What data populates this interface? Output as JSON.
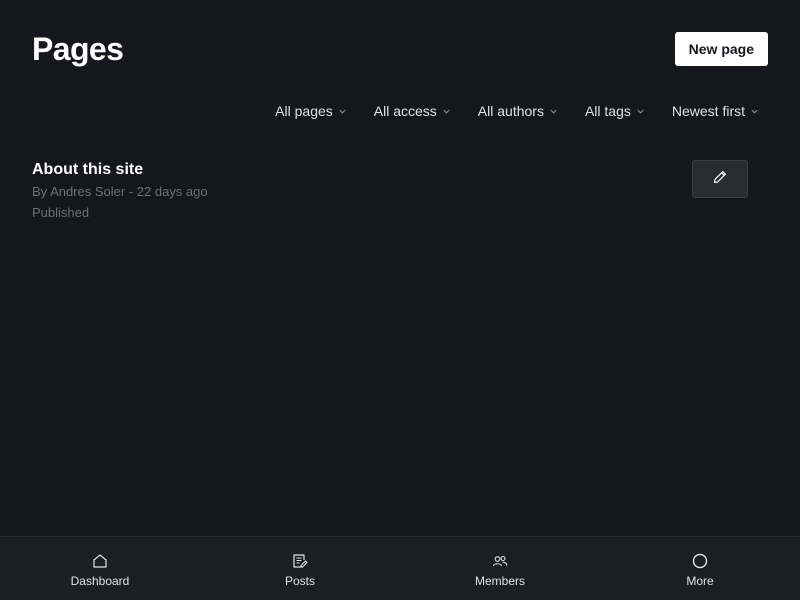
{
  "header": {
    "title": "Pages",
    "new_button_label": "New page"
  },
  "filters": [
    {
      "label": "All pages",
      "icon": "chevron-down-icon"
    },
    {
      "label": "All access",
      "icon": "chevron-down-icon"
    },
    {
      "label": "All authors",
      "icon": "chevron-down-icon"
    },
    {
      "label": "All tags",
      "icon": "chevron-down-icon"
    },
    {
      "label": "Newest first",
      "icon": "chevron-down-icon"
    }
  ],
  "pages": [
    {
      "title": "About this site",
      "meta": "By Andres Soler - 22 days ago",
      "status": "Published",
      "action_icon": "pencil-icon"
    }
  ],
  "bottom_nav": [
    {
      "label": "Dashboard",
      "icon": "home-icon"
    },
    {
      "label": "Posts",
      "icon": "posts-icon"
    },
    {
      "label": "Members",
      "icon": "members-icon"
    },
    {
      "label": "More",
      "icon": "circle-icon"
    }
  ],
  "colors": {
    "background": "#15171c",
    "nav_background": "#1c1e23",
    "muted_text": "#6b6f78",
    "primary_button": "#ffffff"
  }
}
